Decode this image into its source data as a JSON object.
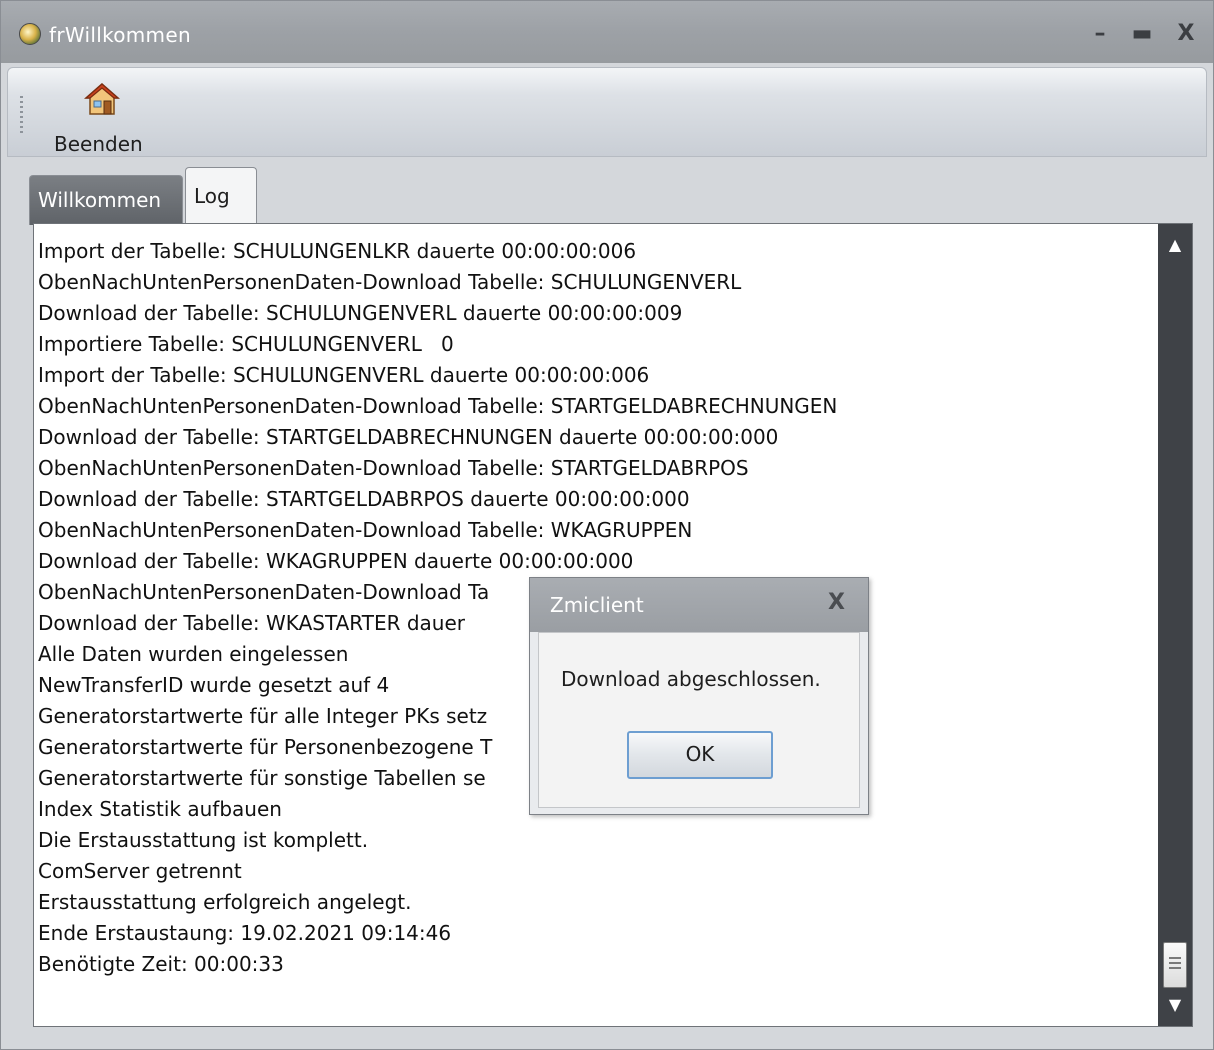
{
  "window": {
    "title": "frWillkommen",
    "minimize_glyph": "–",
    "maximize_glyph": "▬",
    "close_glyph": "X",
    "icon": "app-globe-icon"
  },
  "toolbar": {
    "beenden_label": "Beenden",
    "beenden_icon": "house-icon"
  },
  "tabs": [
    {
      "label": "Willkommen",
      "active": false
    },
    {
      "label": "Log",
      "active": true
    }
  ],
  "log": {
    "lines": [
      "Import der Tabelle: SCHULUNGENLKR dauerte 00:00:00:006",
      "ObenNachUntenPersonenDaten-Download Tabelle: SCHULUNGENVERL",
      "Download der Tabelle: SCHULUNGENVERL dauerte 00:00:00:009",
      "Importiere Tabelle: SCHULUNGENVERL   0",
      "Import der Tabelle: SCHULUNGENVERL dauerte 00:00:00:006",
      "ObenNachUntenPersonenDaten-Download Tabelle: STARTGELDABRECHNUNGEN",
      "Download der Tabelle: STARTGELDABRECHNUNGEN dauerte 00:00:00:000",
      "ObenNachUntenPersonenDaten-Download Tabelle: STARTGELDABRPOS",
      "Download der Tabelle: STARTGELDABRPOS dauerte 00:00:00:000",
      "ObenNachUntenPersonenDaten-Download Tabelle: WKAGRUPPEN",
      "Download der Tabelle: WKAGRUPPEN dauerte 00:00:00:000",
      "ObenNachUntenPersonenDaten-Download Ta",
      "Download der Tabelle: WKASTARTER dauer",
      "Alle Daten wurden eingelessen",
      "NewTransferID wurde gesetzt auf 4",
      "Generatorstartwerte für alle Integer PKs setz",
      "Generatorstartwerte für Personenbezogene T",
      "Generatorstartwerte für sonstige Tabellen se",
      "Index Statistik aufbauen",
      "Die Erstausstattung ist komplett.",
      "ComServer getrennt",
      "Erstausstattung erfolgreich angelegt.",
      "Ende Erstaustaung: 19.02.2021 09:14:46",
      "Benötigte Zeit: 00:00:33"
    ]
  },
  "scrollbar": {
    "up_glyph": "▲",
    "down_glyph": "▼"
  },
  "dialog": {
    "title": "Zmiclient",
    "close_glyph": "X",
    "message": "Download abgeschlossen.",
    "ok_label": "OK"
  }
}
